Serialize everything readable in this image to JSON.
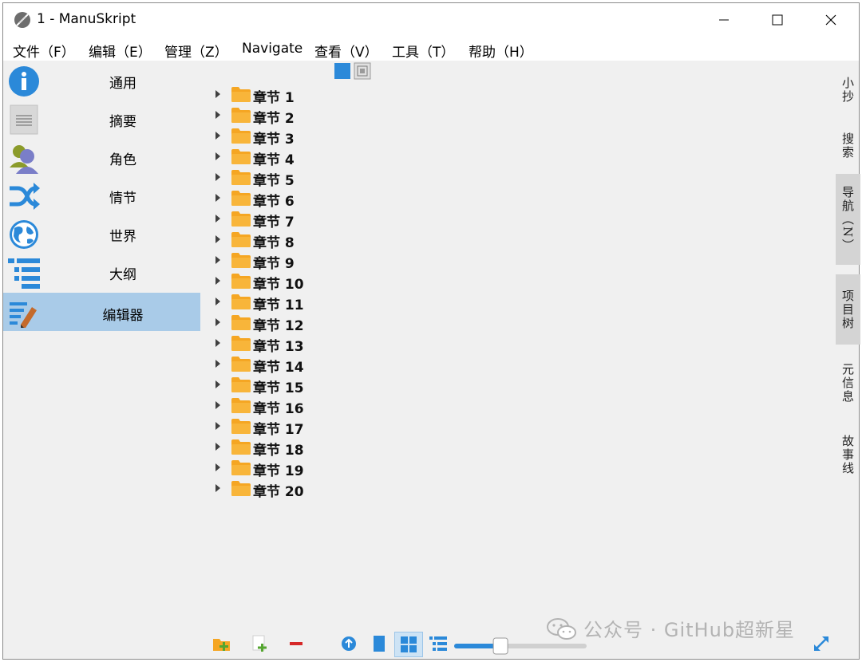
{
  "window": {
    "title": "1 - ManuSkript"
  },
  "menubar": {
    "items": [
      {
        "label": "文件（F）"
      },
      {
        "label": "编辑（E）"
      },
      {
        "label": "管理（Z）"
      },
      {
        "label": "Navigate"
      },
      {
        "label": "查看（V）"
      },
      {
        "label": "工具（T）"
      },
      {
        "label": "帮助（H）"
      }
    ]
  },
  "sidebar": {
    "items": [
      {
        "label": "通用",
        "icon": "info-icon"
      },
      {
        "label": "摘要",
        "icon": "summary-icon"
      },
      {
        "label": "角色",
        "icon": "characters-icon"
      },
      {
        "label": "情节",
        "icon": "plot-icon"
      },
      {
        "label": "世界",
        "icon": "globe-icon"
      },
      {
        "label": "大纲",
        "icon": "outline-icon"
      },
      {
        "label": "编辑器",
        "icon": "editor-icon",
        "active": true
      }
    ]
  },
  "tree": {
    "items": [
      {
        "label": "章节 1"
      },
      {
        "label": "章节 2"
      },
      {
        "label": "章节 3"
      },
      {
        "label": "章节 4"
      },
      {
        "label": "章节 5"
      },
      {
        "label": "章节 6"
      },
      {
        "label": "章节 7"
      },
      {
        "label": "章节 8"
      },
      {
        "label": "章节 9"
      },
      {
        "label": "章节 10"
      },
      {
        "label": "章节 11"
      },
      {
        "label": "章节 12"
      },
      {
        "label": "章节 13"
      },
      {
        "label": "章节 14"
      },
      {
        "label": "章节 15"
      },
      {
        "label": "章节 16"
      },
      {
        "label": "章节 17"
      },
      {
        "label": "章节 18"
      },
      {
        "label": "章节 19"
      },
      {
        "label": "章节 20"
      }
    ]
  },
  "docktabs": {
    "items": [
      {
        "label": "小抄"
      },
      {
        "label": "搜索"
      },
      {
        "label": "导航（N）",
        "active": true
      },
      {
        "label": "项目树",
        "active": true
      },
      {
        "label": "元信息"
      },
      {
        "label": "故事线"
      }
    ]
  },
  "bottombar": {
    "slider_value": 0.35
  },
  "watermark": {
    "text": "公众号 · GitHub超新星"
  },
  "colors": {
    "accent": "#2b89d9",
    "folder": "#f5a623",
    "active_sidebar": "#a9cbe8"
  }
}
